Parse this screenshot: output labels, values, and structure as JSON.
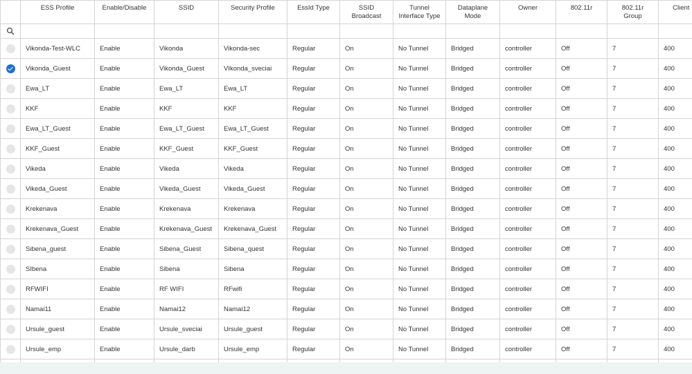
{
  "columns": [
    "",
    "ESS Profile",
    "Enable/Disable",
    "SSID",
    "Security Profile",
    "EssId Type",
    "SSID Broadcast",
    "Tunnel Interface Type",
    "Dataplane Mode",
    "Owner",
    "802.11r",
    "802.11r Group",
    "Client Idle Timeout"
  ],
  "rows": [
    {
      "checked": false,
      "cells": [
        "Vikonda-Test-WLC",
        "Enable",
        "Vikonda",
        "Vikonda-sec",
        "Regular",
        "On",
        "No Tunnel",
        "Bridged",
        "controller",
        "Off",
        "7",
        "400"
      ]
    },
    {
      "checked": true,
      "cells": [
        "Vikonda_Guest",
        "Enable",
        "Vikonda_Guest",
        "VIkonda_sveciai",
        "Regular",
        "On",
        "No Tunnel",
        "Bridged",
        "controller",
        "Off",
        "7",
        "400"
      ]
    },
    {
      "checked": false,
      "cells": [
        "Ewa_LT",
        "Enable",
        "Ewa_LT",
        "Ewa_LT",
        "Regular",
        "On",
        "No Tunnel",
        "Bridged",
        "controller",
        "Off",
        "7",
        "400"
      ]
    },
    {
      "checked": false,
      "cells": [
        "KKF",
        "Enable",
        "KKF",
        "KKF",
        "Regular",
        "On",
        "No Tunnel",
        "Bridged",
        "controller",
        "Off",
        "7",
        "400"
      ]
    },
    {
      "checked": false,
      "cells": [
        "Ewa_LT_Guest",
        "Enable",
        "Ewa_LT_Guest",
        "Ewa_LT_Guest",
        "Regular",
        "On",
        "No Tunnel",
        "Bridged",
        "controller",
        "Off",
        "7",
        "400"
      ]
    },
    {
      "checked": false,
      "cells": [
        "KKF_Guest",
        "Enable",
        "KKF_Guest",
        "KKF_Guest",
        "Regular",
        "On",
        "No Tunnel",
        "Bridged",
        "controller",
        "Off",
        "7",
        "400"
      ]
    },
    {
      "checked": false,
      "cells": [
        "Vikeda",
        "Enable",
        "Vikeda",
        "Vikeda",
        "Regular",
        "On",
        "No Tunnel",
        "Bridged",
        "controller",
        "Off",
        "7",
        "400"
      ]
    },
    {
      "checked": false,
      "cells": [
        "Vikeda_Guest",
        "Enable",
        "Vikeda_Guest",
        "Vikeda_Guest",
        "Regular",
        "On",
        "No Tunnel",
        "Bridged",
        "controller",
        "Off",
        "7",
        "400"
      ]
    },
    {
      "checked": false,
      "cells": [
        "Krekenava",
        "Enable",
        "Krekenava",
        "Krekenava",
        "Regular",
        "On",
        "No Tunnel",
        "Bridged",
        "controller",
        "Off",
        "7",
        "400"
      ]
    },
    {
      "checked": false,
      "cells": [
        "Krekenava_Guest",
        "Enable",
        "Krekenava_Guest",
        "Krekenava_Guest",
        "Regular",
        "On",
        "No Tunnel",
        "Bridged",
        "controller",
        "Off",
        "7",
        "400"
      ]
    },
    {
      "checked": false,
      "cells": [
        "Sibena_guest",
        "Enable",
        "Sibena_Guest",
        "Sibena_quest",
        "Regular",
        "On",
        "No Tunnel",
        "Bridged",
        "controller",
        "Off",
        "7",
        "400"
      ]
    },
    {
      "checked": false,
      "cells": [
        "SIbena",
        "Enable",
        "Sibena",
        "Sibena",
        "Regular",
        "On",
        "No Tunnel",
        "Bridged",
        "controller",
        "Off",
        "7",
        "400"
      ]
    },
    {
      "checked": false,
      "cells": [
        "RFWIFI",
        "Enable",
        "RF WIFI",
        "RFwifi",
        "Regular",
        "On",
        "No Tunnel",
        "Bridged",
        "controller",
        "Off",
        "7",
        "400"
      ]
    },
    {
      "checked": false,
      "cells": [
        "Namai11",
        "Enable",
        "Namai12",
        "Namai12",
        "Regular",
        "On",
        "No Tunnel",
        "Bridged",
        "controller",
        "Off",
        "7",
        "400"
      ]
    },
    {
      "checked": false,
      "cells": [
        "Ursule_guest",
        "Enable",
        "Ursule_sveciai",
        "Ursule_guest",
        "Regular",
        "On",
        "No Tunnel",
        "Bridged",
        "controller",
        "Off",
        "7",
        "400"
      ]
    },
    {
      "checked": false,
      "cells": [
        "Ursule_emp",
        "Enable",
        "Ursule_darb",
        "Ursule_emp",
        "Regular",
        "On",
        "No Tunnel",
        "Bridged",
        "controller",
        "Off",
        "7",
        "400"
      ]
    },
    {
      "checked": false,
      "cells": [
        "",
        "",
        "",
        "",
        "",
        "",
        "",
        "",
        "",
        "",
        "",
        ""
      ]
    }
  ],
  "icons": {
    "filter": "search-icon",
    "selected": "check-icon"
  },
  "colors": {
    "accent": "#1f6fcf",
    "grid": "#d4d4d4",
    "unchecked": "#e6e6e6",
    "page": "#eef3f3"
  }
}
